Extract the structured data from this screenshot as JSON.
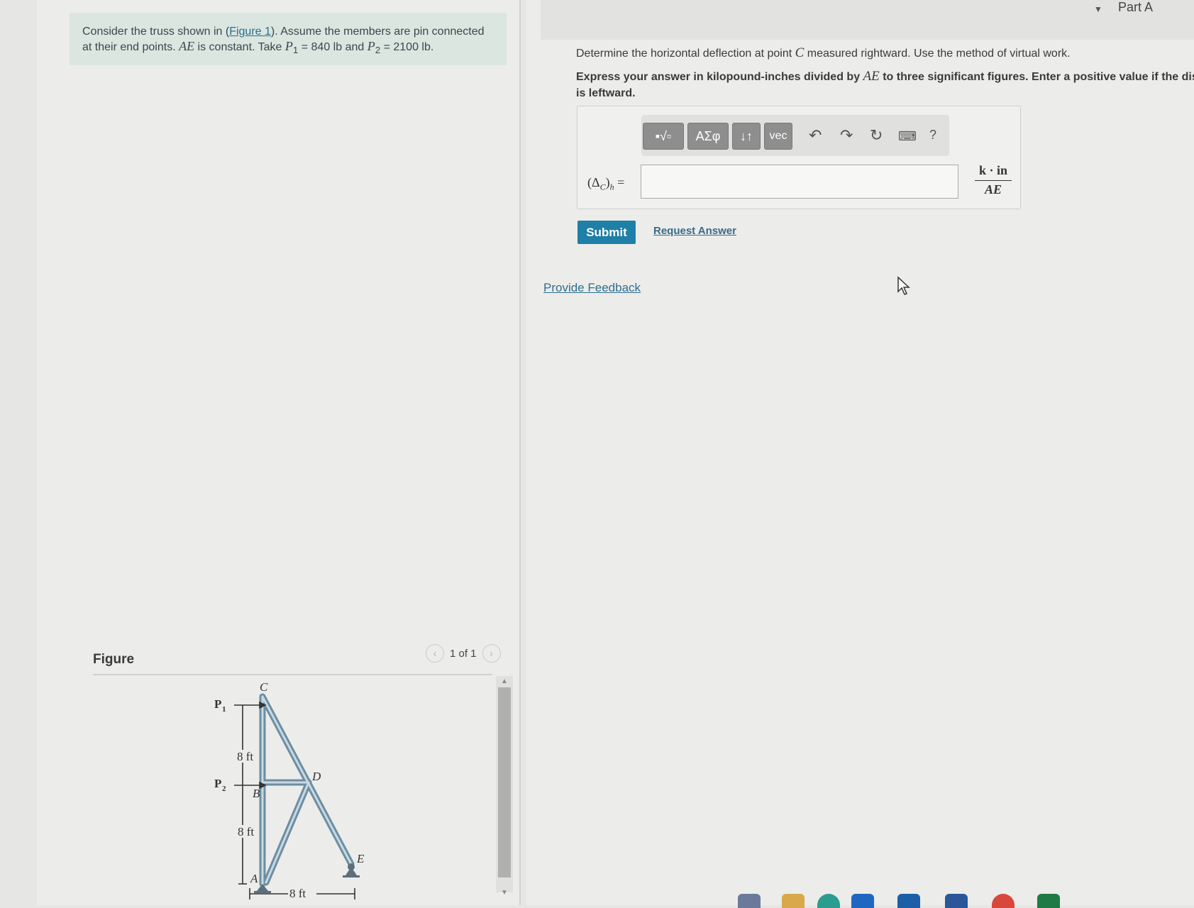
{
  "problem": {
    "text_before_link": "Consider the truss shown in (",
    "link": "Figure 1",
    "text_mid": "). Assume the members are pin connected at their end points. ",
    "ae": "AE",
    "text_take": " is constant. Take ",
    "p1": "P",
    "p1_sub": "1",
    "p1_val": " = 840 lb",
    "and": " and ",
    "p2": "P",
    "p2_sub": "2",
    "p2_val": " = 2100 lb."
  },
  "figure": {
    "title": "Figure",
    "pager": "1 of 1",
    "labels": {
      "c": "C",
      "d": "D",
      "b": "B",
      "a": "A",
      "e": "E",
      "p1": "P",
      "p1_sub": "1",
      "p2": "P",
      "p2_sub": "2",
      "dim_top": "8 ft",
      "dim_bottom": "8 ft",
      "dim_horizontal": "8 ft"
    }
  },
  "part": {
    "title": "Part A",
    "question": "Determine the horizontal deflection at point ",
    "question_point": "C",
    "question_end": " measured rightward. Use the method of virtual work.",
    "instr_a": "Express your answer in kilopound-inches divided by ",
    "instr_ae": "AE",
    "instr_b": " to three significant figures. Enter a positive value if the displ",
    "instr_c": "is leftward."
  },
  "toolbar": {
    "templates": "▪√▫",
    "greek": "ΑΣφ",
    "arrows": "↓↑",
    "vec": "vec",
    "help": "?"
  },
  "answer": {
    "label": "(Δ",
    "label_sub": "C",
    "label_end": ")",
    "label_h": "h",
    "equals": " =",
    "value": "",
    "unit_num": "k · in",
    "unit_den": "AE"
  },
  "buttons": {
    "submit": "Submit",
    "request": "Request Answer",
    "feedback": "Provide Feedback"
  }
}
